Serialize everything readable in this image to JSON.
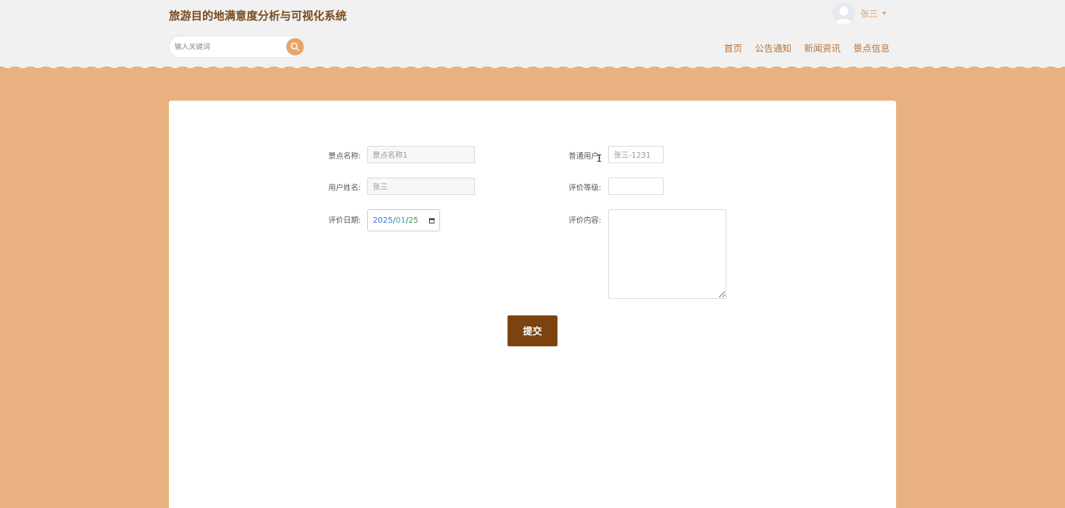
{
  "header": {
    "site_title": "旅游目的地满意度分析与可视化系统",
    "user_name": "张三",
    "search_placeholder": "输入关键词",
    "nav": [
      "首页",
      "公告通知",
      "新闻资讯",
      "景点信息"
    ]
  },
  "form": {
    "spot_name_label": "景点名称:",
    "spot_name_value": "景点名称1",
    "user_label": "普通用户:",
    "user_value": "张三-1231",
    "user_fullname_label": "用户姓名:",
    "user_fullname_value": "张三",
    "rating_label": "评价等级:",
    "rating_value": "",
    "date_label": "评价日期:",
    "date_year": "2025",
    "date_month": "01",
    "date_day": "25",
    "date_sep": "/",
    "content_label": "评价内容:",
    "content_value": "",
    "submit_label": "提交"
  },
  "colors": {
    "background": "#e9b180",
    "header_bg": "#f1f1f1",
    "title": "#7a4a1c",
    "nav": "#b9733a",
    "submit": "#7c4311",
    "search_button": "#e8a469"
  }
}
